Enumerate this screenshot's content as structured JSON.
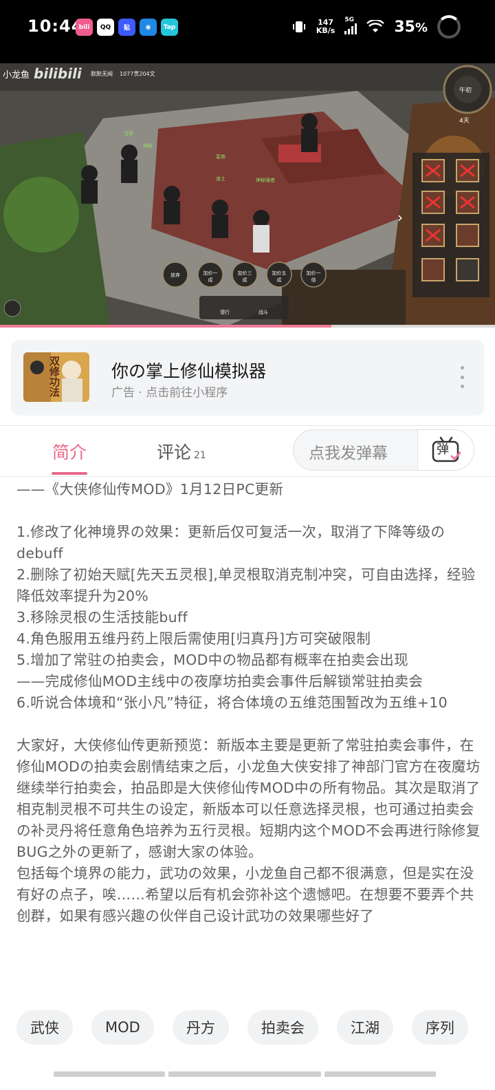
{
  "status_bar": {
    "time": "10:44",
    "apps": [
      {
        "name": "bilibili",
        "label": "bili",
        "color": "#f25d8e"
      },
      {
        "name": "qq",
        "label": "QQ",
        "color": "#ffffff"
      },
      {
        "name": "tieba",
        "label": "贴",
        "color": "#3d5afe"
      },
      {
        "name": "qzone",
        "label": "◉",
        "color": "#1e88e5"
      },
      {
        "name": "taptap",
        "label": "Tap",
        "color": "#26c6da"
      }
    ],
    "net_speed_value": "147",
    "net_speed_unit": "KB/s",
    "network": "5G",
    "battery": "35"
  },
  "video": {
    "uploader_tag": "小龙鱼",
    "watermark": "bilibili",
    "hud_items": [
      "默默无闻",
      "1077贯204文"
    ],
    "clock_label": "午初",
    "day_label": "4天",
    "action_buttons": [
      "放弃",
      "加价一成",
      "加价三成",
      "加价五成",
      "加价一倍"
    ],
    "bottom_labels": [
      "潜行",
      "战斗"
    ],
    "name_tags": [
      "当家",
      "神秘",
      "道士",
      "富商",
      "神秘强者"
    ],
    "progress": 0.67
  },
  "ad": {
    "thumb_text": "双修功法",
    "title": "你の掌上修仙模拟器",
    "subtitle": "广告 · 点击前往小程序"
  },
  "tabs": {
    "intro": "简介",
    "comments": "评论",
    "comments_count": "21",
    "danmu_placeholder": "点我发弹幕",
    "danmu_icon": "弹"
  },
  "description": "——《大侠修仙传MOD》1月12日PC更新\n\n1.修改了化神境界の效果：更新后仅可复活一次，取消了下降等级のdebuff\n2.删除了初始天赋[先天五灵根],单灵根取消克制冲突，可自由选择，经验降低效率提升为20%\n3.移除灵根の生活技能buff\n4.角色服用五维丹药上限后需使用[归真丹]方可突破限制\n5.增加了常驻の拍卖会，MOD中の物品都有概率在拍卖会出现\n——完成修仙MOD主线中の夜摩坊拍卖会事件后解锁常驻拍卖会\n6.听说合体境和“张小凡”特征，将合体境の五维范围暂改为五维+10\n\n大家好，大侠修仙传更新预览：新版本主要是更新了常驻拍卖会事件，在修仙MODの拍卖会剧情结束之后，小龙鱼大侠安排了神部门官方在夜魔坊继续举行拍卖会，拍品即是大侠修仙传MOD中の所有物品。其次是取消了相克制灵根不可共生の设定，新版本可以任意选择灵根，也可通过拍卖会の补灵丹将任意角色培养为五行灵根。短期内这个MOD不会再进行除修复BUG之外の更新了，感谢大家の体验。\n包括每个境界の能力，武功の效果，小龙鱼自己都不很满意，但是实在没有好の点子，唉……希望以后有机会弥补这个遗憾吧。在想要不要弄个共创群，如果有感兴趣の伙伴自己设计武功の效果哪些好了",
  "tags": [
    "武侠",
    "MOD",
    "丹方",
    "拍卖会",
    "江湖",
    "序列"
  ]
}
